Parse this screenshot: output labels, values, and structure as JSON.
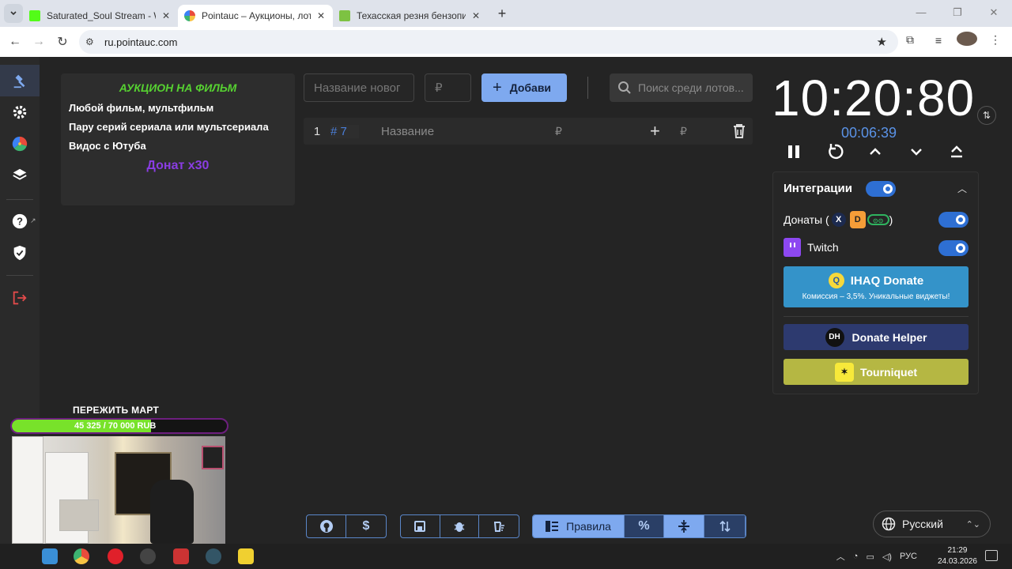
{
  "browser": {
    "tabs": [
      {
        "title": "Saturated_Soul Stream - Watch",
        "active": false,
        "favicon_color": "#53fc18"
      },
      {
        "title": "Pointauc – Аукционы, лотереи",
        "active": true,
        "favicon_color": "#e94b3c"
      },
      {
        "title": "Техасская резня бензопилой (",
        "active": false,
        "favicon_color": "#7dc242"
      }
    ],
    "url": "ru.pointauc.com"
  },
  "rules": {
    "title": "АУКЦИОН НА ФИЛЬМ",
    "lines": [
      "Любой фильм, мультфильм",
      "Пару серий сериала или мультсериала",
      "Видос с Ютуба"
    ],
    "donate": "Донат x30"
  },
  "controls": {
    "name_placeholder": "Название новог",
    "amount_placeholder": "₽",
    "add_label": "Добави",
    "search_placeholder": "Поиск среди лотов..."
  },
  "lots": [
    {
      "index": "1",
      "id": "# 7",
      "name": "Название",
      "currency": "₽"
    }
  ],
  "timer": {
    "main": "10:20:80",
    "sub": "00:06:39"
  },
  "integrations": {
    "title": "Интеграции",
    "donations_label": "Донаты (",
    "donations_close": ")",
    "twitch_label": "Twitch",
    "ihaq_title": "IHAQ Donate",
    "ihaq_sub": "Комиссия – 3,5%. Уникальные виджеты!",
    "donate_helper": "Donate Helper",
    "tourniquet": "Tourniquet"
  },
  "toolbar": {
    "rules_label": "Правила"
  },
  "language": "Русский",
  "overlay": {
    "goal_title": "ПЕРЕЖИТЬ МАРТ",
    "goal_text": "45 325 / 70 000 RUB",
    "goal_progress": 0.6476
  },
  "taskbar": {
    "lang": "РУС",
    "time": "21:29",
    "date": "24.03.2026"
  },
  "colors": {
    "accent": "#7ea9ef",
    "toggle": "#2e6fd3",
    "rules_title": "#56d131",
    "rules_donate": "#8a3de3",
    "ihaq": "#3493c9",
    "donate_helper": "#2d3a6f",
    "tourniquet": "#b5b743"
  }
}
